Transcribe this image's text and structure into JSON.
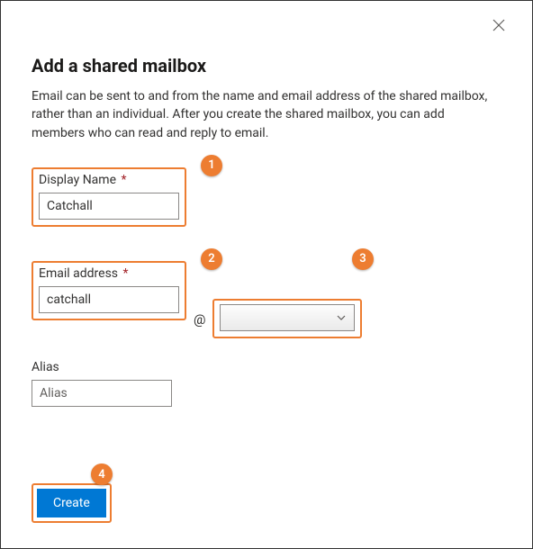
{
  "title": "Add a shared mailbox",
  "description": "Email can be sent to and from the name and email address of the shared mailbox, rather than an individual. After you create the shared mailbox, you can add members who can read and reply to email.",
  "fields": {
    "display_name": {
      "label": "Display Name",
      "required_mark": "*",
      "value": "Catchall"
    },
    "email": {
      "label": "Email address",
      "required_mark": "*",
      "value": "catchall",
      "at": "@"
    },
    "domain": {
      "selected": ""
    },
    "alias": {
      "label": "Alias",
      "placeholder": "Alias",
      "value": ""
    }
  },
  "buttons": {
    "create": "Create"
  },
  "annotations": {
    "b1": "1",
    "b2": "2",
    "b3": "3",
    "b4": "4"
  },
  "colors": {
    "accent": "#0078d4",
    "callout": "#ed7d31"
  }
}
